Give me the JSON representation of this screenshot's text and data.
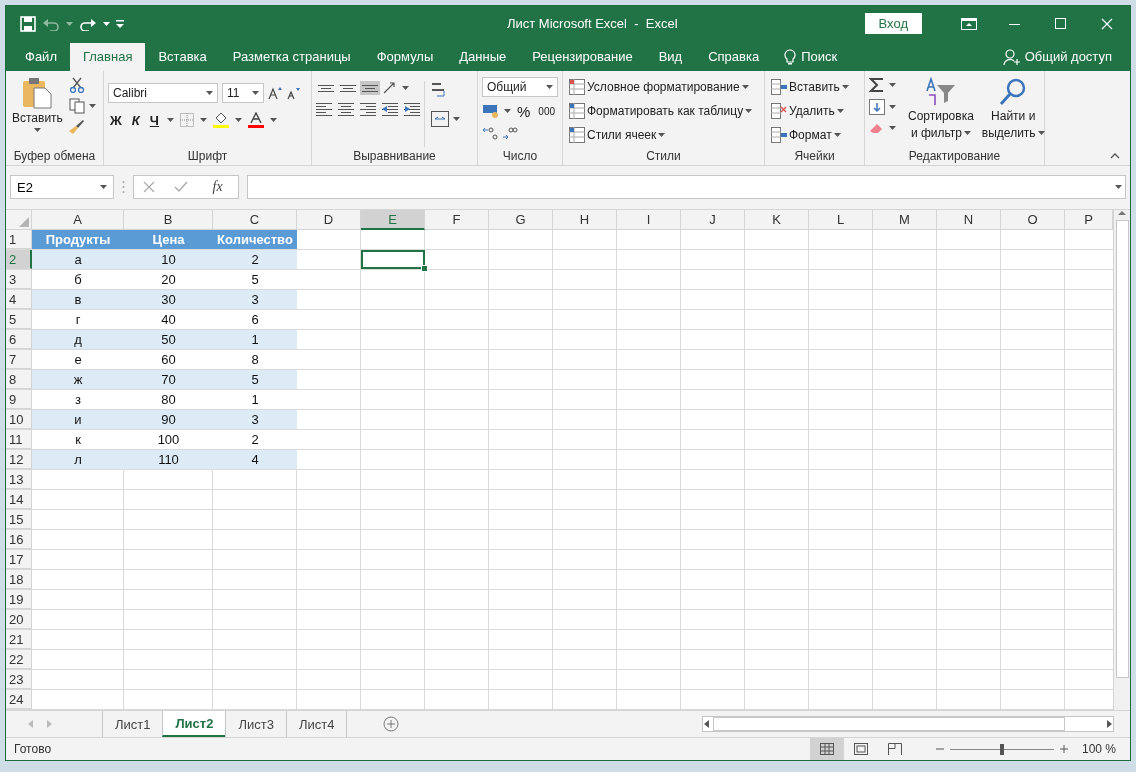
{
  "window": {
    "title": "Лист Microsoft Excel  -  Excel",
    "sign_in": "Вход"
  },
  "ribbon_tabs": [
    {
      "label": "Файл",
      "selected": false
    },
    {
      "label": "Главная",
      "selected": true
    },
    {
      "label": "Вставка",
      "selected": false
    },
    {
      "label": "Разметка страницы",
      "selected": false
    },
    {
      "label": "Формулы",
      "selected": false
    },
    {
      "label": "Данные",
      "selected": false
    },
    {
      "label": "Рецензирование",
      "selected": false
    },
    {
      "label": "Вид",
      "selected": false
    },
    {
      "label": "Справка",
      "selected": false
    }
  ],
  "search": "Поиск",
  "share": "Общий доступ",
  "clipboard": {
    "label": "Буфер обмена",
    "paste": "Вставить"
  },
  "font": {
    "label": "Шрифт",
    "font_name": "Calibri",
    "font_size": "11",
    "bold": "Ж",
    "italic": "К",
    "underline": "Ч"
  },
  "alignment": {
    "label": "Выравнивание",
    "vertical": [
      {
        "selected": false
      },
      {
        "selected": false
      },
      {
        "selected": true
      }
    ]
  },
  "number": {
    "label": "Число",
    "format": "Общий",
    "percent": "%",
    "thousands": "000"
  },
  "styles": {
    "label": "Стили",
    "items": [
      "Условное форматирование",
      "Форматировать как таблицу",
      "Стили ячеек"
    ]
  },
  "cells": {
    "label": "Ячейки",
    "items": [
      "Вставить",
      "Удалить",
      "Формат"
    ]
  },
  "editing": {
    "label": "Редактирование",
    "sort": [
      "Сортировка",
      "и фильтр"
    ],
    "find": [
      "Найти и",
      "выделить"
    ]
  },
  "formula_bar": {
    "name_box": "E2",
    "function_button": "fx"
  },
  "sheet": {
    "columns": [
      {
        "label": "A",
        "selected": false
      },
      {
        "label": "B",
        "selected": false
      },
      {
        "label": "C",
        "selected": false
      },
      {
        "label": "D",
        "selected": false
      },
      {
        "label": "E",
        "selected": true
      },
      {
        "label": "F",
        "selected": false
      },
      {
        "label": "G",
        "selected": false
      },
      {
        "label": "H",
        "selected": false
      },
      {
        "label": "I",
        "selected": false
      },
      {
        "label": "J",
        "selected": false
      },
      {
        "label": "K",
        "selected": false
      },
      {
        "label": "L",
        "selected": false
      },
      {
        "label": "M",
        "selected": false
      },
      {
        "label": "N",
        "selected": false
      },
      {
        "label": "O",
        "selected": false
      },
      {
        "label": "P",
        "selected": false
      }
    ],
    "rows": [
      {
        "number": "1",
        "selected": false,
        "kind": "header",
        "cells": [
          "Продукты",
          "Цена",
          "Количество"
        ]
      },
      {
        "number": "2",
        "selected": true,
        "kind": "shaded",
        "cells": [
          "а",
          "10",
          "2"
        ]
      },
      {
        "number": "3",
        "selected": false,
        "kind": "plain",
        "cells": [
          "б",
          "20",
          "5"
        ]
      },
      {
        "number": "4",
        "selected": false,
        "kind": "shaded",
        "cells": [
          "в",
          "30",
          "3"
        ]
      },
      {
        "number": "5",
        "selected": false,
        "kind": "plain",
        "cells": [
          "г",
          "40",
          "6"
        ]
      },
      {
        "number": "6",
        "selected": false,
        "kind": "shaded",
        "cells": [
          "д",
          "50",
          "1"
        ]
      },
      {
        "number": "7",
        "selected": false,
        "kind": "plain",
        "cells": [
          "е",
          "60",
          "8"
        ]
      },
      {
        "number": "8",
        "selected": false,
        "kind": "shaded",
        "cells": [
          "ж",
          "70",
          "5"
        ]
      },
      {
        "number": "9",
        "selected": false,
        "kind": "plain",
        "cells": [
          "з",
          "80",
          "1"
        ]
      },
      {
        "number": "10",
        "selected": false,
        "kind": "shaded",
        "cells": [
          "и",
          "90",
          "3"
        ]
      },
      {
        "number": "11",
        "selected": false,
        "kind": "plain",
        "cells": [
          "к",
          "100",
          "2"
        ]
      },
      {
        "number": "12",
        "selected": false,
        "kind": "shaded",
        "cells": [
          "л",
          "110",
          "4"
        ]
      },
      {
        "number": "13",
        "selected": false
      },
      {
        "number": "14",
        "selected": false
      },
      {
        "number": "15",
        "selected": false
      },
      {
        "number": "16",
        "selected": false
      },
      {
        "number": "17",
        "selected": false
      },
      {
        "number": "18",
        "selected": false
      },
      {
        "number": "19",
        "selected": false
      },
      {
        "number": "20",
        "selected": false
      },
      {
        "number": "21",
        "selected": false
      },
      {
        "number": "22",
        "selected": false
      },
      {
        "number": "23",
        "selected": false
      },
      {
        "number": "24",
        "selected": false
      }
    ]
  },
  "sheet_tabs": [
    {
      "label": "Лист1",
      "selected": false
    },
    {
      "label": "Лист2",
      "selected": true
    },
    {
      "label": "Лист3",
      "selected": false
    },
    {
      "label": "Лист4",
      "selected": false
    }
  ],
  "status_bar": {
    "status": "Готово",
    "views": [
      {
        "kind": "normal",
        "selected": true
      },
      {
        "kind": "page-layout",
        "selected": false
      },
      {
        "kind": "page-break",
        "selected": false
      }
    ],
    "zoom": {
      "level": 0.5,
      "reading": "100 %"
    }
  }
}
